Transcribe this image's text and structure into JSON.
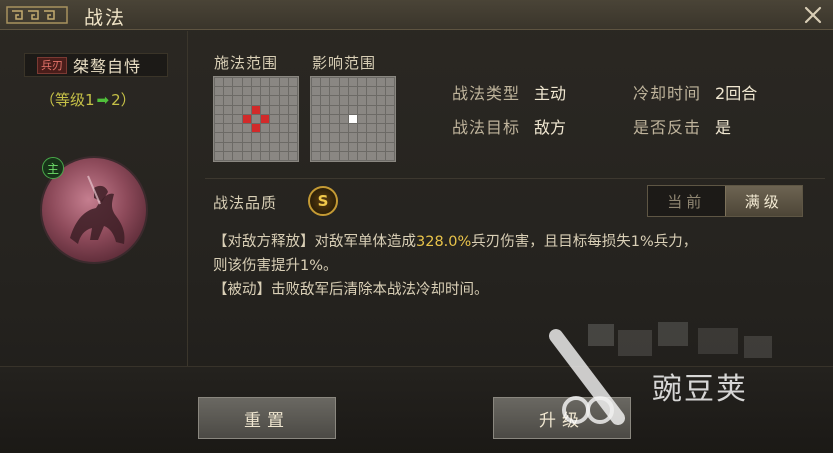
{
  "window": {
    "title": "战法"
  },
  "skill": {
    "type_tag": "兵刃",
    "name": "桀骜自恃",
    "level_prefix": "（等级1",
    "level_suffix": "2）",
    "portrait_badge": "主"
  },
  "range": {
    "cast_label": "施法范围",
    "effect_label": "影响范围"
  },
  "info": {
    "type_label": "战法类型",
    "type_value": "主动",
    "cooldown_label": "冷却时间",
    "cooldown_value": "2回合",
    "target_label": "战法目标",
    "target_value": "敌方",
    "counter_label": "是否反击",
    "counter_value": "是"
  },
  "quality": {
    "label": "战法品质",
    "grade": "S"
  },
  "toggle": {
    "current_label": "当前",
    "max_label": "满级"
  },
  "description": {
    "part1": "【对敌方释放】对敌军单体造成",
    "damage": "328.0%",
    "part2": "兵刃伤害，且目标每损失1%兵力，",
    "line2": "则该伤害提升1%。",
    "line3": "【被动】击败敌军后清除本战法冷却时间。"
  },
  "buttons": {
    "reset": "重置",
    "upgrade": "升级"
  },
  "watermark": {
    "text": "豌豆荚"
  },
  "colors": {
    "accent_yellow": "#e8c34a",
    "level_green": "#4fbf3a",
    "range_red": "#d22a2a"
  }
}
